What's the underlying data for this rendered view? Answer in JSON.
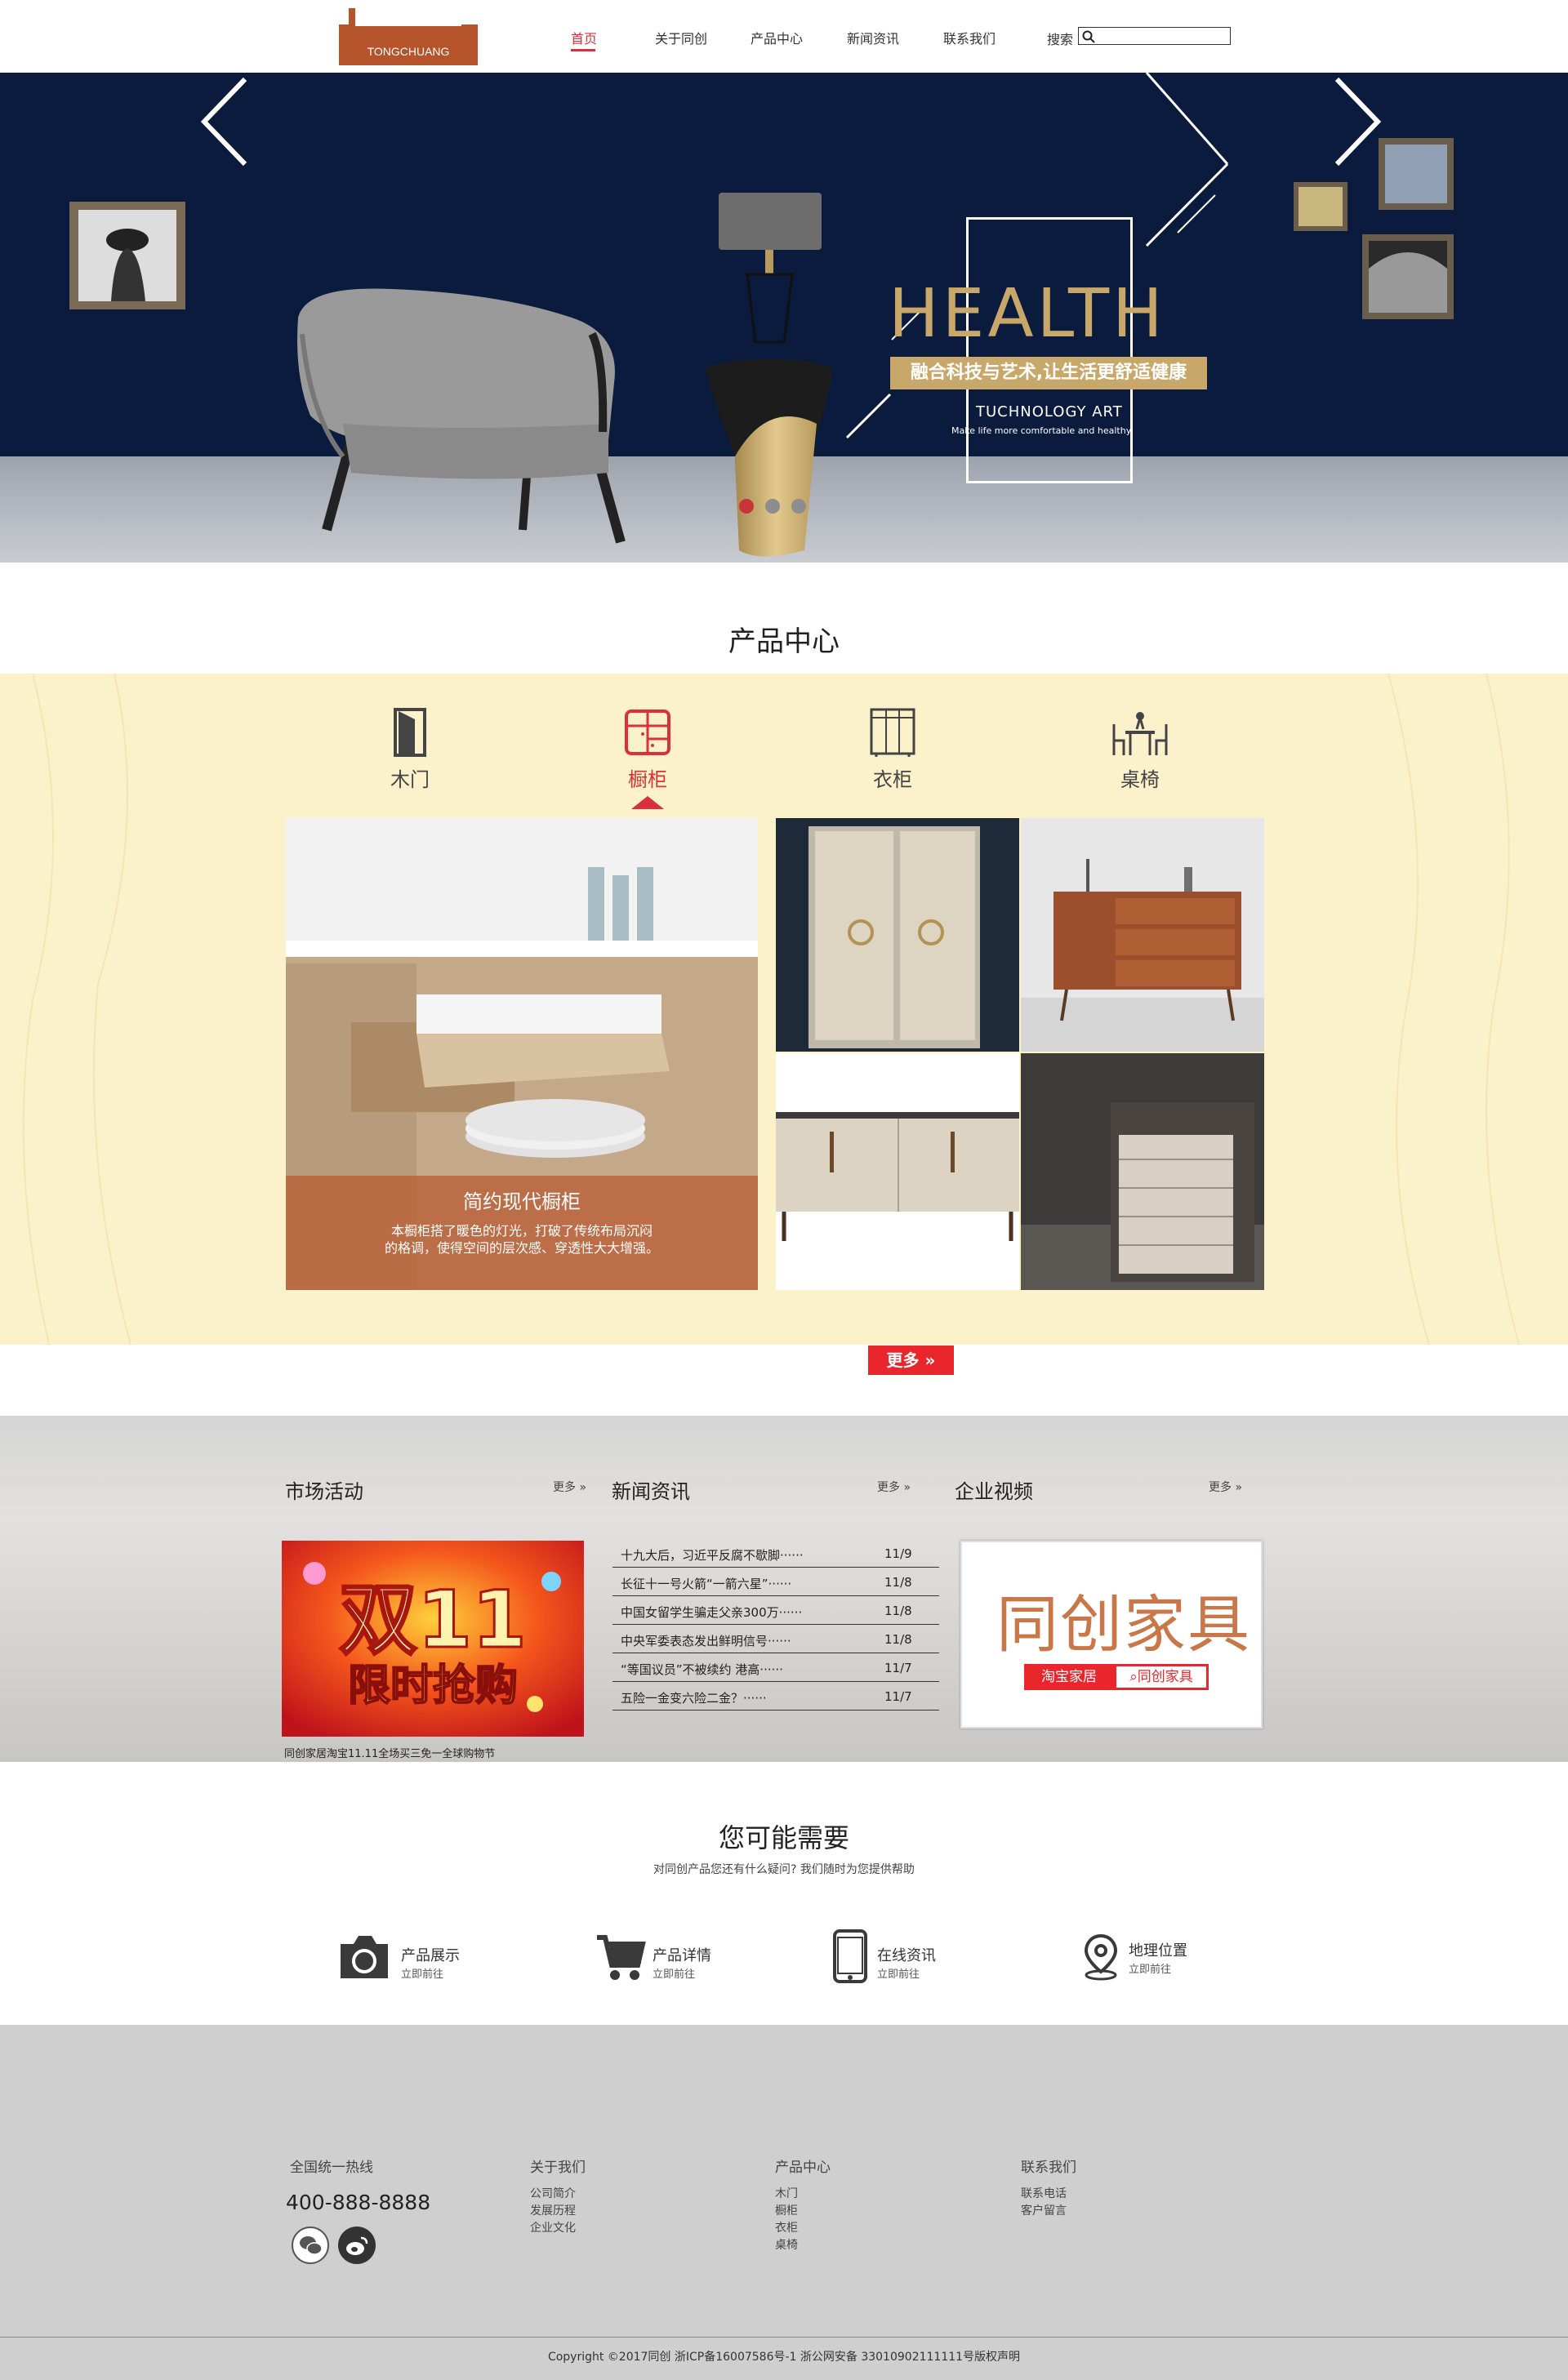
{
  "header": {
    "logo_text": "TONGCHUANG",
    "nav": [
      "首页",
      "关于同创",
      "产品中心",
      "新闻资讯",
      "联系我们"
    ],
    "search_label": "搜索",
    "search_placeholder": ""
  },
  "banner": {
    "title": "HEALTH",
    "slogan": "融合科技与艺术,让生活更舒适健康",
    "sub": "TUCHNOLOGY ART",
    "tagline": "Make life more comfortable and healthy",
    "active_dot": 0,
    "dot_count": 3
  },
  "products": {
    "title": "产品中心",
    "categories": [
      {
        "label": "木门",
        "icon": "door-icon"
      },
      {
        "label": "橱柜",
        "icon": "cabinet-icon"
      },
      {
        "label": "衣柜",
        "icon": "wardrobe-icon"
      },
      {
        "label": "桌椅",
        "icon": "table-chair-icon"
      }
    ],
    "active_category": 1,
    "feature_title": "简约现代橱柜",
    "feature_desc_line1": "本橱柜搭了暖色的灯光，打破了传统布局沉闷",
    "feature_desc_line2": "的格调，使得空间的层次感、穿透性大大增强。",
    "more_label": "更多"
  },
  "news": {
    "market": {
      "title": "市场活动",
      "more": "更多",
      "promo_caption": "同创家居淘宝11.11全场买三免一全球购物节",
      "promo_big": "双11",
      "promo_small": "限时抢购"
    },
    "news_col": {
      "title": "新闻资讯",
      "more": "更多",
      "items": [
        {
          "title": "十九大后，习近平反腐不歇脚······",
          "date": "11/9"
        },
        {
          "title": "长征十一号火箭“一箭六星”······",
          "date": "11/8"
        },
        {
          "title": "中国女留学生骗走父亲300万······",
          "date": "11/8"
        },
        {
          "title": "中央军委表态发出鲜明信号······",
          "date": "11/8"
        },
        {
          "title": "“等国议员”不被续约 港高······",
          "date": "11/7"
        },
        {
          "title": "五险一金变六险二金？······",
          "date": "11/7"
        }
      ]
    },
    "video": {
      "title": "企业视频",
      "more": "更多",
      "logo": "同创家具",
      "btn_left": "淘宝家居",
      "btn_right": "同创家具"
    }
  },
  "need": {
    "title": "您可能需要",
    "subtitle": "对同创产品您还有什么疑问? 我们随时为您提供帮助",
    "items": [
      {
        "title": "产品展示",
        "sub": "立即前往",
        "icon": "camera-icon"
      },
      {
        "title": "产品详情",
        "sub": "立即前往",
        "icon": "cart-icon"
      },
      {
        "title": "在线资讯",
        "sub": "立即前往",
        "icon": "phone-icon"
      },
      {
        "title": "地理位置",
        "sub": "立即前往",
        "icon": "location-icon"
      }
    ]
  },
  "footer": {
    "hotline_label": "全国统一热线",
    "hotline": "400-888-8888",
    "about": {
      "title": "关于我们",
      "links": [
        "公司简介",
        "发展历程",
        "企业文化"
      ]
    },
    "products": {
      "title": "产品中心",
      "links": [
        "木门",
        "橱柜",
        "衣柜",
        "桌椅"
      ]
    },
    "contact": {
      "title": "联系我们",
      "links": [
        "联系电话",
        "客户留言"
      ]
    },
    "copyright": "Copyright ©2017同创 浙ICP备16007586号-1  浙公网安备 33010902111111号版权声明"
  },
  "colors": {
    "accent": "#d9303c",
    "banner_bg": "#0b1b3d",
    "gold": "#c8a76a",
    "product_bg": "#fbf2cb",
    "footer_bg": "#cfcfcf"
  }
}
